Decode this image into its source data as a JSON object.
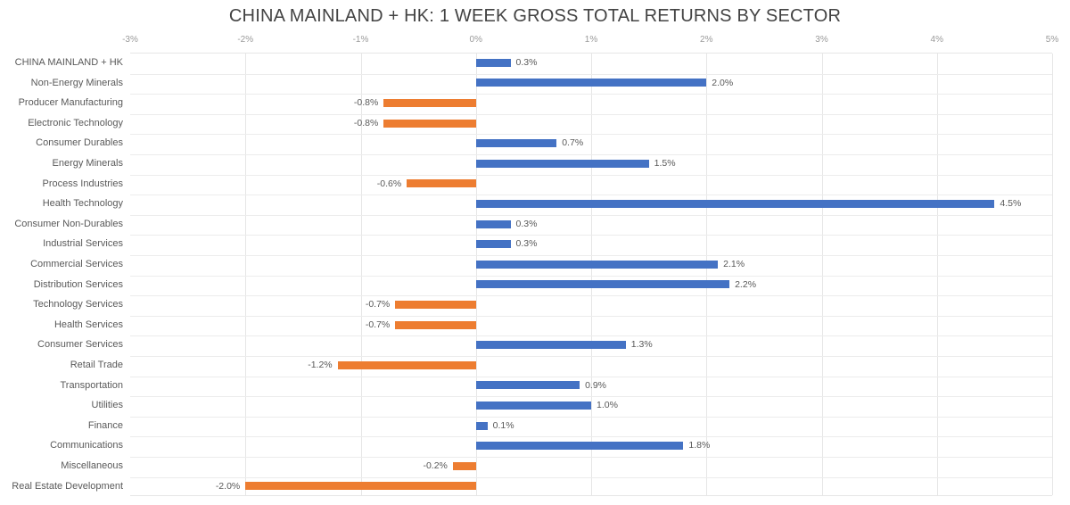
{
  "chart_data": {
    "type": "bar",
    "orientation": "horizontal",
    "title": "CHINA MAINLAND + HK: 1 WEEK GROSS TOTAL RETURNS BY SECTOR",
    "xlabel": "",
    "ylabel": "",
    "xlim": [
      -3,
      5
    ],
    "xticks": [
      -3,
      -2,
      -1,
      0,
      1,
      2,
      3,
      4,
      5
    ],
    "xtick_labels": [
      "-3%",
      "-2%",
      "-1%",
      "0%",
      "1%",
      "2%",
      "3%",
      "4%",
      "5%"
    ],
    "grid": true,
    "legend": "none",
    "value_format": "0.0%",
    "colors": {
      "positive": "#4472c4",
      "negative": "#ed7d31",
      "gridline": "#e6e6e6",
      "text": "#595959",
      "title": "#434343",
      "tick": "#9a9a9a"
    },
    "categories": [
      "CHINA MAINLAND + HK",
      "Non-Energy Minerals",
      "Producer Manufacturing",
      "Electronic Technology",
      "Consumer Durables",
      "Energy Minerals",
      "Process Industries",
      "Health Technology",
      "Consumer Non-Durables",
      "Industrial Services",
      "Commercial Services",
      "Distribution Services",
      "Technology Services",
      "Health Services",
      "Consumer Services",
      "Retail Trade",
      "Transportation",
      "Utilities",
      "Finance",
      "Communications",
      "Miscellaneous",
      "Real Estate Development"
    ],
    "values": [
      0.3,
      2.0,
      -0.8,
      -0.8,
      0.7,
      1.5,
      -0.6,
      4.5,
      0.3,
      0.3,
      2.1,
      2.2,
      -0.7,
      -0.7,
      1.3,
      -1.2,
      0.9,
      1.0,
      0.1,
      1.8,
      -0.2,
      -2.0
    ],
    "data_labels": [
      "0.3%",
      "2.0%",
      "-0.8%",
      "-0.8%",
      "0.7%",
      "1.5%",
      "-0.6%",
      "4.5%",
      "0.3%",
      "0.3%",
      "2.1%",
      "2.2%",
      "-0.7%",
      "-0.7%",
      "1.3%",
      "-1.2%",
      "0.9%",
      "1.0%",
      "0.1%",
      "1.8%",
      "-0.2%",
      "-2.0%"
    ]
  }
}
